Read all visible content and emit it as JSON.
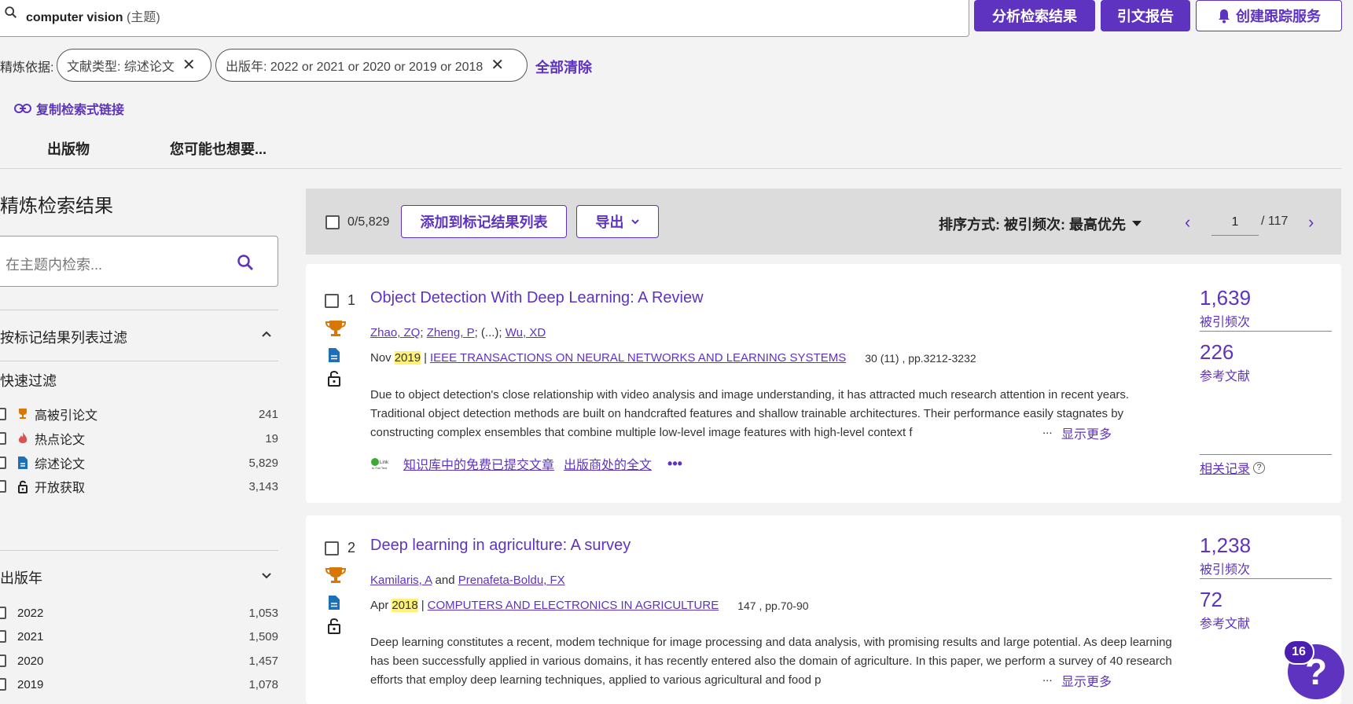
{
  "search": {
    "query": "computer vision",
    "field": "(主题)"
  },
  "header_buttons": {
    "analyze": "分析检索结果",
    "citation_report": "引文报告",
    "create_alert": "创建跟踪服务"
  },
  "refine": {
    "label": "精炼依据:",
    "chips": [
      {
        "text": "文献类型: 综述论文"
      },
      {
        "text": "出版年: 2022 or 2021 or 2020 or 2019 or 2018"
      }
    ],
    "clear_all": "全部清除"
  },
  "copy_link": "复制检索式链接",
  "tabs": {
    "publications": "出版物",
    "you_may_like": "您可能也想要..."
  },
  "sidebar": {
    "title": "精炼检索结果",
    "topic_search_placeholder": "在主题内检索...",
    "mark_filter": "按标记结果列表过滤",
    "quick_filter_title": "快速过滤",
    "quick_filters": [
      {
        "label": "高被引论文",
        "count": "241",
        "icon": "trophy-icon",
        "color": "#d97706"
      },
      {
        "label": "热点论文",
        "count": "19",
        "icon": "fire-icon",
        "color": "#d9534f"
      },
      {
        "label": "综述论文",
        "count": "5,829",
        "icon": "document-icon",
        "color": "#1d6fb8"
      },
      {
        "label": "开放获取",
        "count": "3,143",
        "icon": "unlock-icon",
        "color": "#222"
      }
    ],
    "year_title": "出版年",
    "years": [
      {
        "label": "2022",
        "count": "1,053"
      },
      {
        "label": "2021",
        "count": "1,509"
      },
      {
        "label": "2020",
        "count": "1,457"
      },
      {
        "label": "2019",
        "count": "1,078"
      }
    ]
  },
  "toolbar": {
    "selected": "0/5,829",
    "add_to_marked": "添加到标记结果列表",
    "export": "导出",
    "sort": "排序方式: 被引频次: 最高优先",
    "page_current": "1",
    "page_total": "/ 117"
  },
  "records": [
    {
      "num": "1",
      "title": "Object Detection With Deep Learning: A Review",
      "authors": [
        "Zhao, ZQ",
        "Zheng, P",
        "Wu, XD"
      ],
      "authors_sep": "; (...); ",
      "month": "Nov",
      "year": "2019",
      "journal": "IEEE TRANSACTIONS ON NEURAL NETWORKS AND LEARNING SYSTEMS",
      "volume": "30 (11) , pp.3212-3232",
      "abstract": "Due to object detection's close relationship with video analysis and image understanding, it has attracted much research attention in recent years. Traditional object detection methods are built on handcrafted features and shallow trainable architectures. Their performance easily stagnates by constructing complex ensembles that combine multiple low-level image features with high-level context f",
      "show_more": "显示更多",
      "ellipsis": "...",
      "link_free": "知识库中的免费已提交文章",
      "link_fulltext": "出版商处的全文",
      "times_cited": "1,639",
      "times_cited_label": "被引频次",
      "refs": "226",
      "refs_label": "参考文献",
      "related": "相关记录"
    },
    {
      "num": "2",
      "title": "Deep learning in agriculture: A survey",
      "authors": [
        "Kamilaris, A",
        "Prenafeta-Boldu, FX"
      ],
      "authors_sep": " and ",
      "month": "Apr",
      "year": "2018",
      "journal": "COMPUTERS AND ELECTRONICS IN AGRICULTURE",
      "volume": "147 , pp.70-90",
      "abstract": "Deep learning constitutes a recent, modem technique for image processing and data analysis, with promising results and large potential. As deep learning has been successfully applied in various domains, it has recently entered also the domain of agriculture. In this paper, we perform a survey of 40 research efforts that employ deep learning techniques, applied to various agricultural and food p",
      "show_more": "显示更多",
      "ellipsis": "...",
      "times_cited": "1,238",
      "times_cited_label": "被引频次",
      "refs": "72",
      "refs_label": "参考文献"
    }
  ],
  "help": {
    "badge": "16",
    "symbol": "?"
  },
  "colors": {
    "accent": "#5e33bf",
    "highlight": "#fff176",
    "trophy": "#d97706"
  }
}
